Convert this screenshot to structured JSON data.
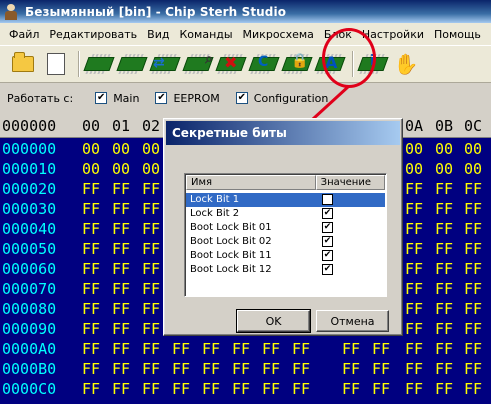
{
  "window": {
    "title": "Безымянный [bin] - Chip Sterh Studio"
  },
  "menu": {
    "items": [
      "Файл",
      "Редактировать",
      "Вид",
      "Команды",
      "Микросхема",
      "Блок",
      "Настройки",
      "Помощь"
    ]
  },
  "toolbar": {
    "buttons": [
      "open-folder-icon",
      "new-document-icon",
      "chip-read-icon",
      "chip-write-icon",
      "chip-transfer-icon",
      "chip-search-icon",
      "chip-erase-icon",
      "chip-config-icon",
      "chip-lock-icon",
      "chip-text-icon",
      "chip-info-icon",
      "hand-icon"
    ]
  },
  "options": {
    "label": "Работать с:",
    "main": "Main",
    "eeprom": "EEPROM",
    "configuration": "Configuration"
  },
  "hex": {
    "header_addr": "000000",
    "columns": [
      "00",
      "01",
      "02",
      "0A",
      "0B",
      "0C"
    ],
    "rows": [
      {
        "addr": "000000",
        "val": "00"
      },
      {
        "addr": "000010",
        "val": "00"
      },
      {
        "addr": "000020",
        "val": "FF"
      },
      {
        "addr": "000030",
        "val": "FF"
      },
      {
        "addr": "000040",
        "val": "FF"
      },
      {
        "addr": "000050",
        "val": "FF"
      },
      {
        "addr": "000060",
        "val": "FF"
      },
      {
        "addr": "000070",
        "val": "FF"
      },
      {
        "addr": "000080",
        "val": "FF"
      },
      {
        "addr": "000090",
        "val": "FF"
      },
      {
        "addr": "0000A0",
        "val": "FF"
      },
      {
        "addr": "0000B0",
        "val": "FF"
      },
      {
        "addr": "0000C0",
        "val": "FF"
      }
    ]
  },
  "dialog": {
    "title": "Секретные биты",
    "col_name": "Имя",
    "col_value": "Значение",
    "items": [
      {
        "name": "Lock Bit 1",
        "checked": true
      },
      {
        "name": "Lock Bit 2",
        "checked": true
      },
      {
        "name": "Boot Lock Bit 01",
        "checked": true
      },
      {
        "name": "Boot Lock Bit 02",
        "checked": true
      },
      {
        "name": "Boot Lock Bit 11",
        "checked": true
      },
      {
        "name": "Boot Lock Bit 12",
        "checked": true
      }
    ],
    "selected_index": 0,
    "ok": "OK",
    "cancel": "Отмена"
  },
  "colors": {
    "hex_background": "#000080",
    "address": "#00ffff",
    "value": "#ffff00",
    "annotation": "#e0001a"
  }
}
